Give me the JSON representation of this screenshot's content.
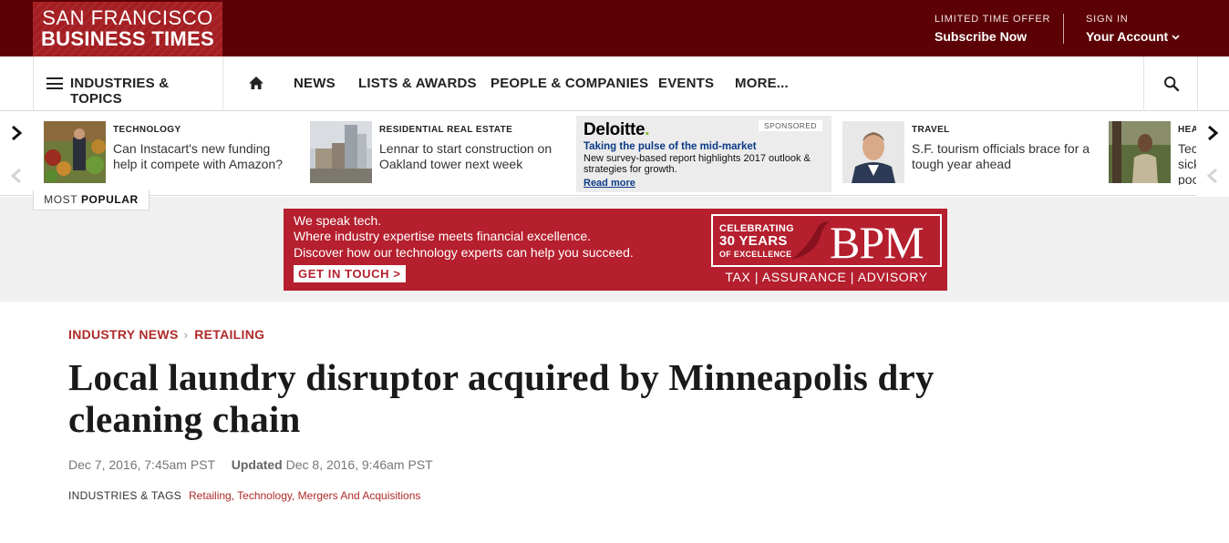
{
  "header": {
    "logo_line1": "SAN FRANCISCO",
    "logo_line2": "BUSINESS TIMES",
    "offer_small": "LIMITED TIME OFFER",
    "offer_link": "Subscribe Now",
    "signin_small": "SIGN IN",
    "account_link": "Your Account",
    "colors": {
      "top_bar": "#5c0206",
      "logo_bg": "#a41e22"
    }
  },
  "nav": {
    "industries_label": "INDUSTRIES & TOPICS",
    "links": [
      "NEWS",
      "LISTS & AWARDS",
      "PEOPLE & COMPANIES",
      "EVENTS",
      "MORE..."
    ],
    "icons": {
      "menu": "hamburger-icon",
      "home": "home-icon",
      "search": "search-icon"
    }
  },
  "carousel": {
    "items": [
      {
        "category": "TECHNOLOGY",
        "title": "Can Instacart's new funding help it compete with Amazon?"
      },
      {
        "category": "RESIDENTIAL REAL ESTATE",
        "title": "Lennar to start construction on Oakland tower next week"
      },
      {
        "category": "TRAVEL",
        "title": "S.F. tourism officials brace for a tough year ahead"
      },
      {
        "category": "HEA",
        "title": "Tec sick poc"
      }
    ],
    "sponsored": {
      "brand": "Deloitte",
      "brand_dot": ".",
      "badge": "SPONSORED",
      "headline": "Taking the pulse of the mid-market",
      "body": "New survey-based report highlights 2017 outlook & strategies for growth.",
      "link": "Read more"
    },
    "most_popular_prefix": "MOST",
    "most_popular_bold": "POPULAR"
  },
  "ad": {
    "line1": "We speak tech.",
    "line2": "Where industry expertise meets financial excellence.",
    "line3": "Discover how our technology experts can help you succeed.",
    "cta": "GET IN TOUCH >",
    "celebrating": "CELEBRATING",
    "years": "30 YEARS",
    "excellence": "OF EXCELLENCE",
    "brand": "BPM",
    "services": "TAX | ASSURANCE | ADVISORY",
    "color": "#b51f2e"
  },
  "article": {
    "breadcrumb": [
      "INDUSTRY NEWS",
      "RETAILING"
    ],
    "headline_line1": "Local laundry disruptor acquired by Minneapolis dry",
    "headline_line2": "cleaning chain",
    "published": "Dec 7, 2016, 7:45am PST",
    "updated_label": "Updated",
    "updated": "Dec 8, 2016, 9:46am PST",
    "tags_label": "INDUSTRIES & TAGS",
    "tags": "Retailing, Technology, Mergers And Acquisitions",
    "accent_color": "#b02a2a"
  }
}
